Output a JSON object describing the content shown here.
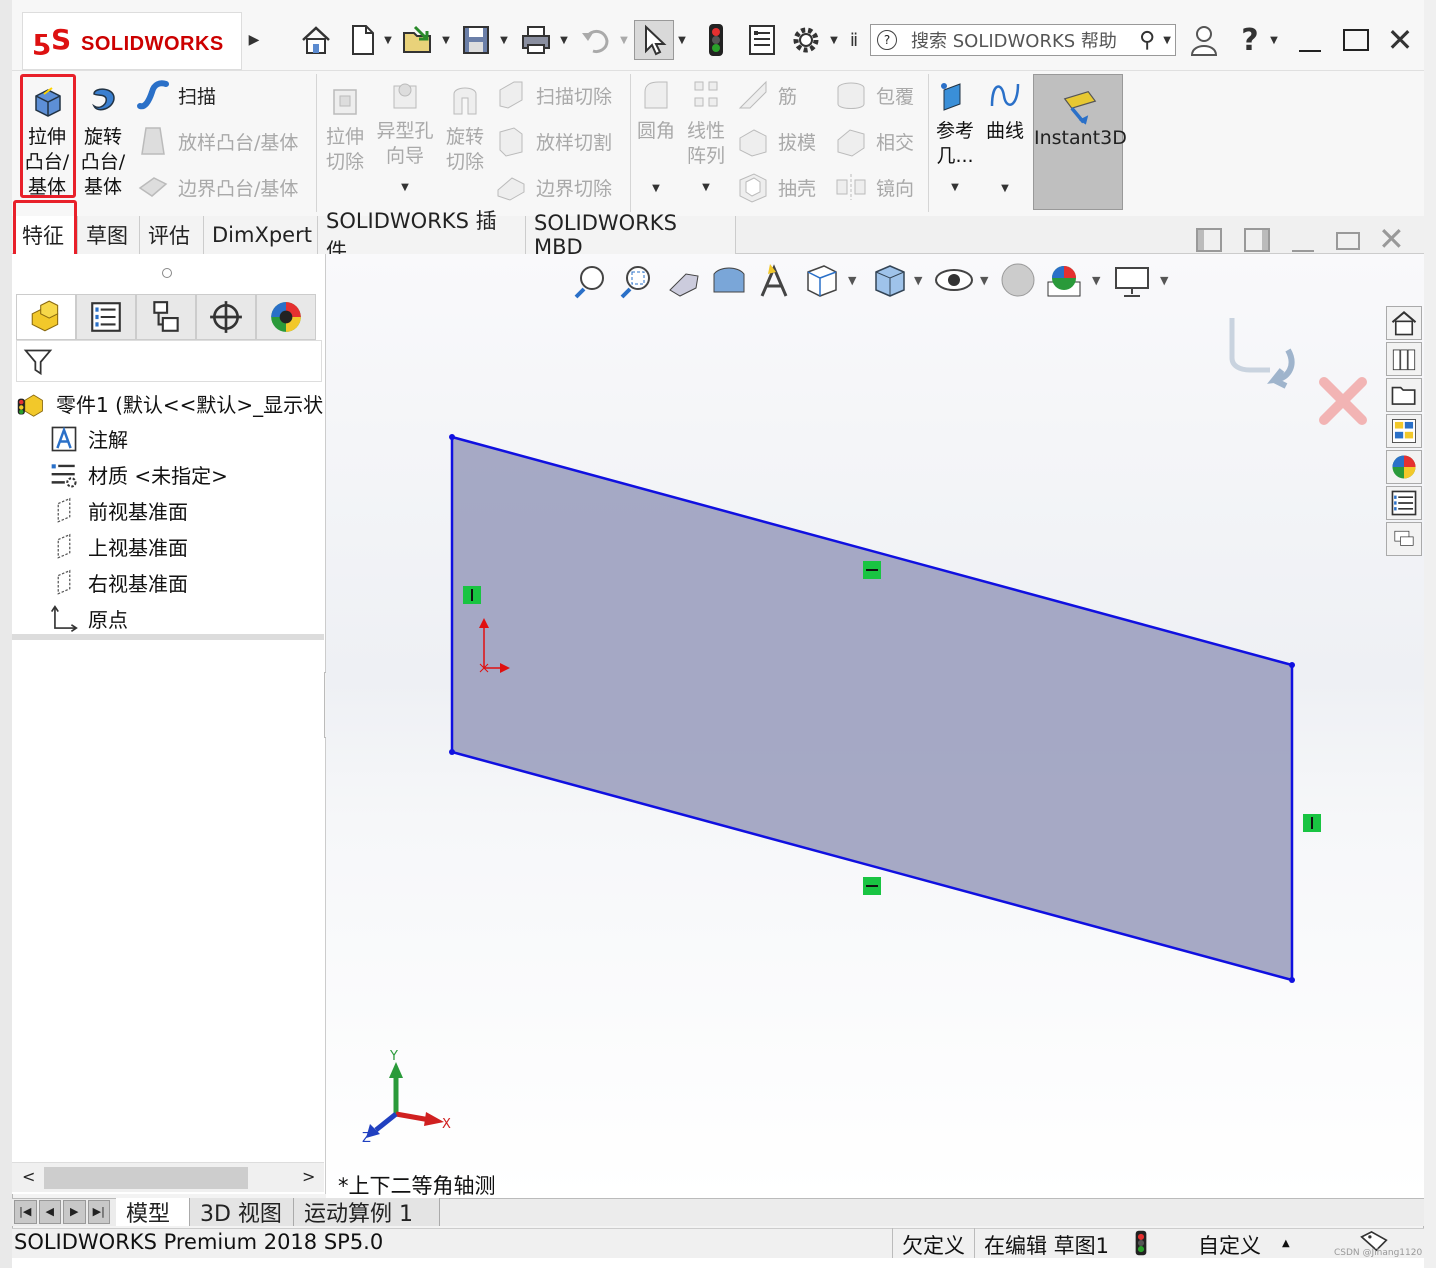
{
  "app": {
    "logo_text": "SOLIDWORKS",
    "search_placeholder": "搜索 SOLIDWORKS 帮助",
    "help_glyph": "?"
  },
  "ribbon": {
    "extrude_boss": [
      "拉伸",
      "凸台/",
      "基体"
    ],
    "revolve_boss": [
      "旋转",
      "凸台/",
      "基体"
    ],
    "sweep": "扫描",
    "loft_boss": "放样凸台/基体",
    "boundary_boss": "边界凸台/基体",
    "extrude_cut": [
      "拉伸",
      "切除"
    ],
    "hole_wizard": [
      "异型孔",
      "向导"
    ],
    "revolve_cut": [
      "旋转",
      "切除"
    ],
    "sweep_cut": "扫描切除",
    "loft_cut": "放样切割",
    "boundary_cut": "边界切除",
    "fillet": "圆角",
    "linear_pattern": [
      "线性",
      "阵列"
    ],
    "rib": "筋",
    "draft": "拔模",
    "shell": "抽壳",
    "wrap": "包覆",
    "intersect": "相交",
    "mirror": "镜向",
    "reference_geometry": [
      "参考",
      "几..."
    ],
    "curves": "曲线",
    "instant3d": "Instant3D"
  },
  "tabs": [
    "特征",
    "草图",
    "评估",
    "DimXpert",
    "SOLIDWORKS 插件",
    "SOLIDWORKS MBD"
  ],
  "tree": {
    "root": "零件1  (默认<<默认>_显示状",
    "items": [
      "注解",
      "材质 <未指定>",
      "前视基准面",
      "上视基准面",
      "右视基准面",
      "原点"
    ]
  },
  "viewport": {
    "view_name": "*上下二等角轴测",
    "axis_labels": {
      "x": "X",
      "y": "Y",
      "z": "Z"
    }
  },
  "bottom_tabs": [
    "模型",
    "3D 视图",
    "运动算例 1"
  ],
  "status": {
    "product": "SOLIDWORKS Premium 2018 SP5.0",
    "underdefined": "欠定义",
    "editing": "在编辑 草图1",
    "custom": "自定义",
    "watermark": "CSDN @Jihang1120"
  },
  "colors": {
    "highlight": "#e8202a",
    "sketch_line": "#1010e0",
    "sketch_fill": "#9ea2c0",
    "relation_marker": "#19c442"
  }
}
